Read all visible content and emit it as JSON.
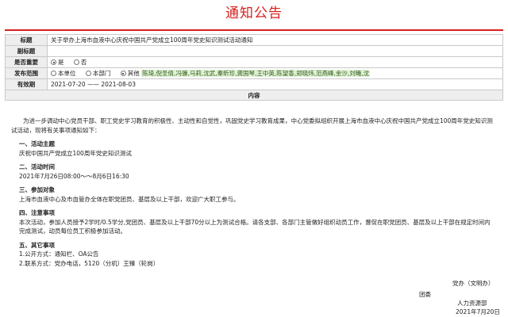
{
  "header": {
    "title": "通知公告"
  },
  "form": {
    "rows": [
      {
        "label": "标题",
        "value": "关于举办上海市血液中心庆祝中国共产党成立100周年党史知识测试活动通知"
      },
      {
        "label": "副标题",
        "value": ""
      },
      {
        "label": "是否重要",
        "options": [
          {
            "label": "是",
            "selected": true
          },
          {
            "label": "否",
            "selected": false
          }
        ]
      },
      {
        "label": "发布范围",
        "options": [
          {
            "label": "本单位",
            "selected": false
          },
          {
            "label": "本部门",
            "selected": false
          },
          {
            "label": "其他",
            "selected": true
          }
        ],
        "scope_list": "陈琦,倪圣倩,冯骥,马莉,沈武,秦昕珍,龚国琴,王中英,陈望香,郑晓炜,范燕峰,金沙,刘曦,沈"
      },
      {
        "label": "有效期",
        "start": "2021-07-20",
        "separator": "——",
        "end": "2021-08-03"
      }
    ],
    "content_label": "内容"
  },
  "notice": {
    "intro": "为进一步调动中心党员干部、职工党史学习教育的积极性、主动性和自觉性，巩固党史学习教育成果，中心党委拟组织开展上海市血液中心庆祝中国共产党成立100周年党史知识测试活动，现将有关事项通知如下：",
    "sections": [
      {
        "title": "一、活动主题",
        "lines": [
          "庆祝中国共产党成立100周年党史知识测试"
        ]
      },
      {
        "title": "二、活动时间",
        "lines": [
          "2021年7月26日08:00～～8月6日16:30"
        ]
      },
      {
        "title": "三、参加对象",
        "lines": [
          "上海市血液中心及市血管办全体在职党团员、基层及以上干部，欢迎广大职工参与。"
        ]
      },
      {
        "title": "四、注意事项",
        "lines": [
          "本次活动，参加人员授予2学时/0.5学分,党团员、基层及以上干部70分以上为测试合格。请各支部、各部门主管做好组织动员工作，督促在职党团员、基层及以上干部在规定时间内完成测试，动员每位员工积极参加活动。"
        ]
      },
      {
        "title": "五、其它事项",
        "lines": [
          "1.公开方式：通知栏、OA公告",
          "2.联系方式：党办电话，5120（分机）王臻（轮岗）"
        ]
      }
    ],
    "signatures": [
      "党办（文明办）",
      "团委",
      "人力资源部"
    ],
    "date": "2021年7月20日"
  }
}
